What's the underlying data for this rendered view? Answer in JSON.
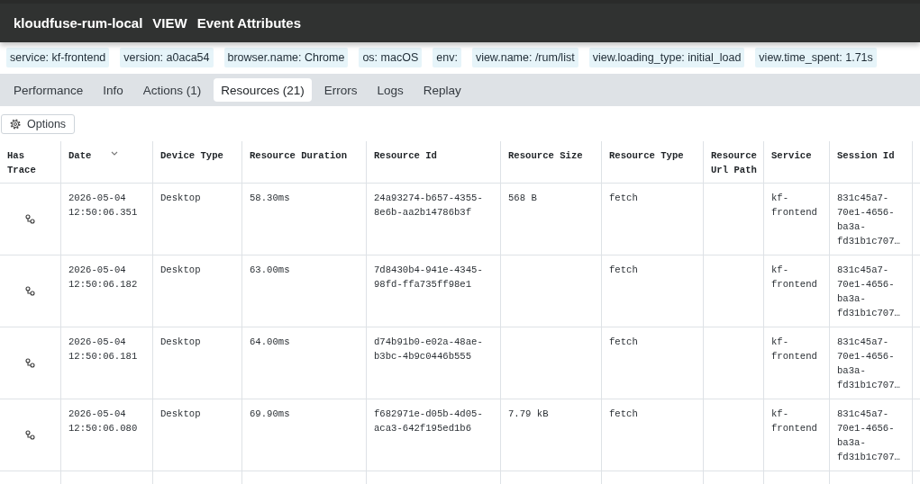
{
  "header": {
    "app_name": "kloudfuse-rum-local",
    "event_type": "VIEW",
    "title": "Event Attributes"
  },
  "attributes": [
    "service: kf-frontend",
    "version: a0aca54",
    "browser.name: Chrome",
    "os: macOS",
    "env:",
    "view.name: /rum/list",
    "view.loading_type: initial_load",
    "view.time_spent: 1.71s"
  ],
  "tabs": [
    {
      "label": "Performance",
      "selected": false
    },
    {
      "label": "Info",
      "selected": false
    },
    {
      "label": "Actions (1)",
      "selected": false
    },
    {
      "label": "Resources (21)",
      "selected": true
    },
    {
      "label": "Errors",
      "selected": false
    },
    {
      "label": "Logs",
      "selected": false
    },
    {
      "label": "Replay",
      "selected": false
    }
  ],
  "options_button": {
    "label": "Options"
  },
  "table": {
    "columns": [
      {
        "label": "Has Trace",
        "kind": "trace"
      },
      {
        "label": "Date",
        "kind": "text",
        "sorted": true
      },
      {
        "label": "Device Type",
        "kind": "text"
      },
      {
        "label": "Resource Duration",
        "kind": "text"
      },
      {
        "label": "Resource Id",
        "kind": "text"
      },
      {
        "label": "Resource Size",
        "kind": "text"
      },
      {
        "label": "Resource Type",
        "kind": "text"
      },
      {
        "label": "Resource Url Path",
        "kind": "text"
      },
      {
        "label": "Service",
        "kind": "text"
      },
      {
        "label": "Session Id",
        "kind": "text"
      }
    ],
    "rows": [
      {
        "has_trace": true,
        "cells": [
          "",
          "2026-05-04 12:50:06.351",
          "Desktop",
          "58.30ms",
          "24a93274-b657-4355-8e6b-aa2b14786b3f",
          "568 B",
          "fetch",
          "",
          "kf-frontend",
          "831c45a7-70e1-4656-ba3a-fd31b1c707…"
        ]
      },
      {
        "has_trace": true,
        "cells": [
          "",
          "2026-05-04 12:50:06.182",
          "Desktop",
          "63.00ms",
          "7d8430b4-941e-4345-98fd-ffa735ff98e1",
          "",
          "fetch",
          "",
          "kf-frontend",
          "831c45a7-70e1-4656-ba3a-fd31b1c707…"
        ]
      },
      {
        "has_trace": true,
        "cells": [
          "",
          "2026-05-04 12:50:06.181",
          "Desktop",
          "64.00ms",
          "d74b91b0-e02a-48ae-b3bc-4b9c0446b555",
          "",
          "fetch",
          "",
          "kf-frontend",
          "831c45a7-70e1-4656-ba3a-fd31b1c707…"
        ]
      },
      {
        "has_trace": true,
        "cells": [
          "",
          "2026-05-04 12:50:06.080",
          "Desktop",
          "69.90ms",
          "f682971e-d05b-4d05-aca3-642f195ed1b6",
          "7.79 kB",
          "fetch",
          "",
          "kf-frontend",
          "831c45a7-70e1-4656-ba3a-fd31b1c707…"
        ]
      }
    ]
  }
}
